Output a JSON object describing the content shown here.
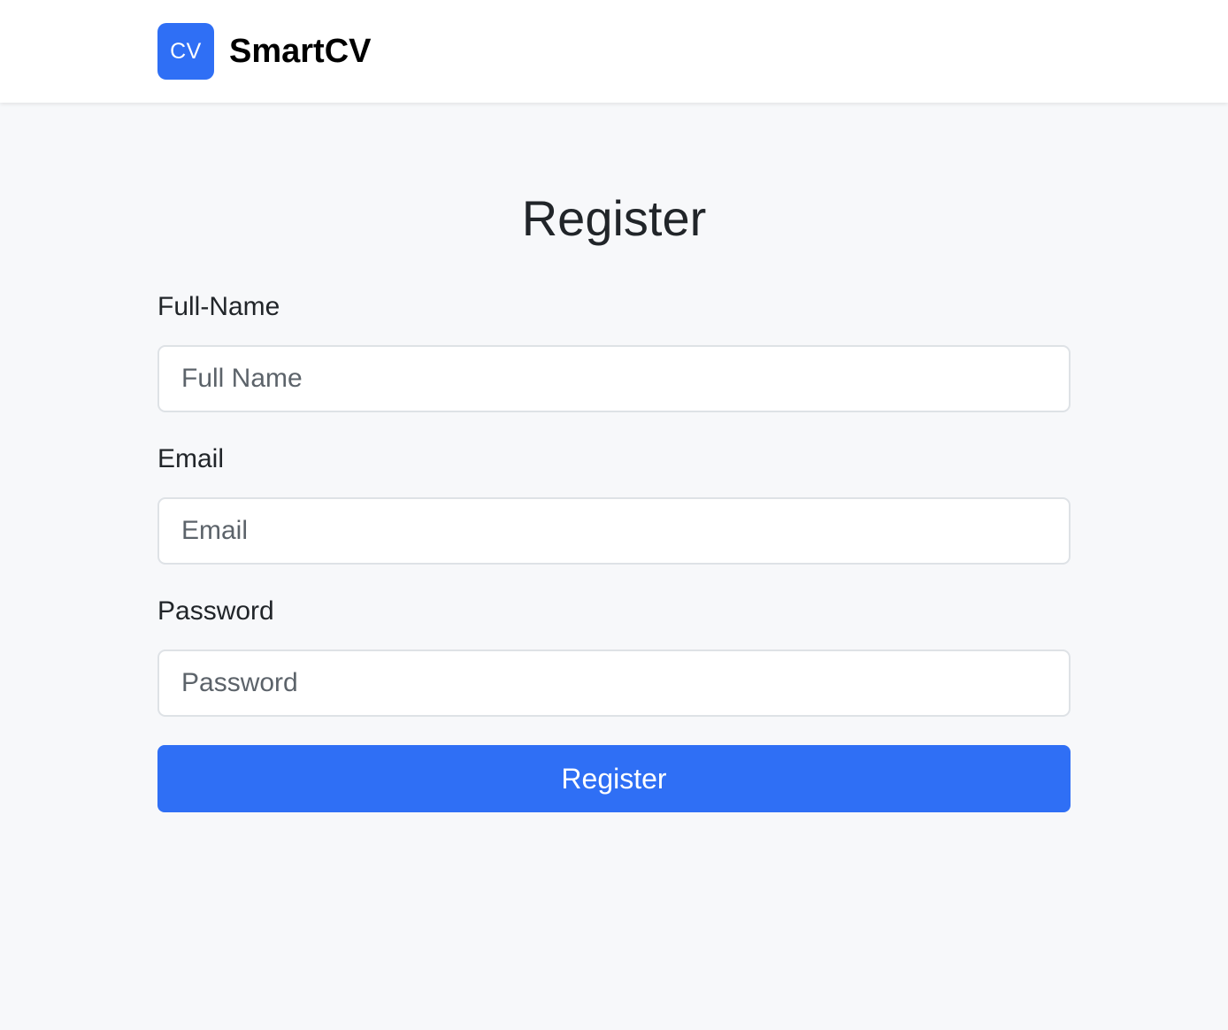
{
  "navbar": {
    "logo_text": "CV",
    "brand_name": "SmartCV"
  },
  "page": {
    "title": "Register"
  },
  "form": {
    "full_name": {
      "label": "Full-Name",
      "placeholder": "Full Name",
      "value": ""
    },
    "email": {
      "label": "Email",
      "placeholder": "Email",
      "value": ""
    },
    "password": {
      "label": "Password",
      "placeholder": "Password",
      "value": ""
    },
    "submit_label": "Register"
  },
  "colors": {
    "accent": "#2f6ff5",
    "page_background": "#f7f8fa",
    "navbar_background": "#ffffff"
  }
}
